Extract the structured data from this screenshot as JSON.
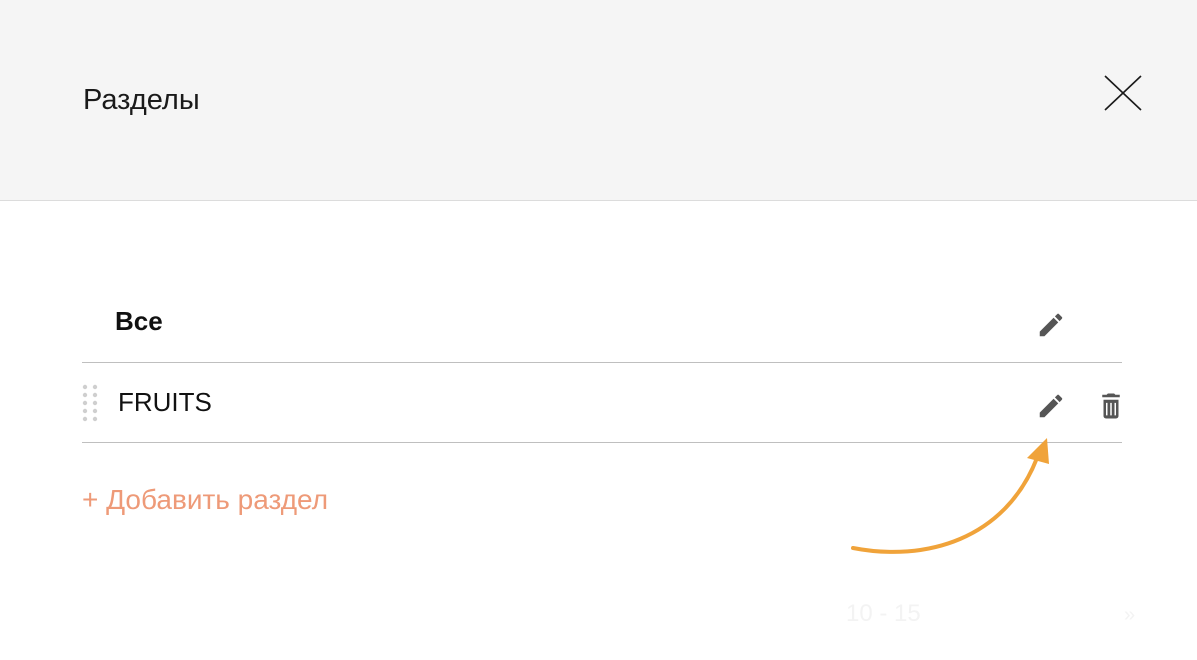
{
  "modal": {
    "title": "Разделы"
  },
  "sections": [
    {
      "label": "Все",
      "bold": true,
      "draggable": false,
      "deletable": false
    },
    {
      "label": "FRUITS",
      "bold": false,
      "draggable": true,
      "deletable": true
    }
  ],
  "add_section_label": "+ Добавить раздел",
  "background_hint": {
    "range_text": "10 - 15",
    "chevron": "»"
  },
  "colors": {
    "header_bg": "#f5f5f5",
    "divider": "#bfbfbf",
    "add_link": "#ee9a78",
    "annotation_arrow": "#f0a33a",
    "icon": "#555555"
  },
  "icons": {
    "close": "close-x-icon",
    "edit": "pencil-icon",
    "delete": "trash-icon",
    "drag": "drag-dots-icon"
  }
}
